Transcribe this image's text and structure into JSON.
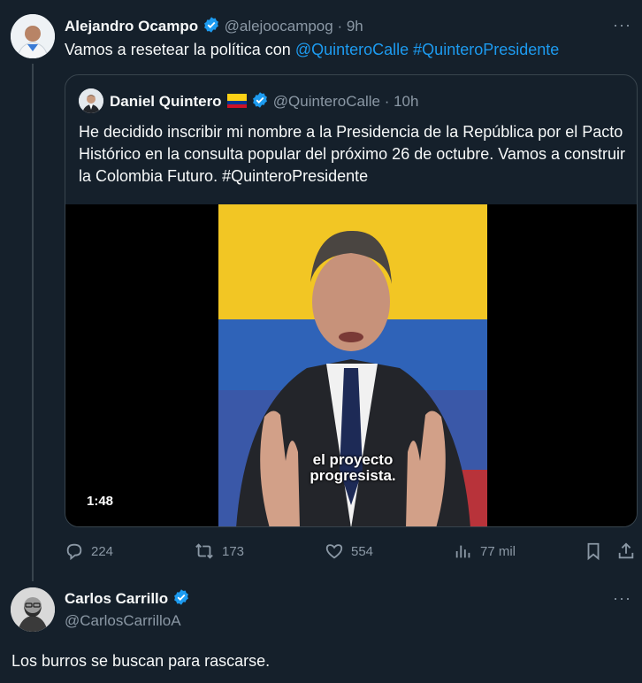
{
  "tweet1": {
    "name": "Alejandro Ocampo",
    "handle": "@alejoocampog",
    "time": "· 9h",
    "text_prefix": "Vamos a resetear la política con",
    "mention": "@QuinteroCalle",
    "hashtag": "#QuinteroPresidente"
  },
  "quote": {
    "name": "Daniel Quintero",
    "handle": "@QuinteroCalle",
    "time": "· 10h",
    "text": "He decidido inscribir mi nombre a la Presidencia de la República por el Pacto Histórico en la consulta popular del próximo 26 de octubre. Vamos a construir la Colombia Futuro. #QuinteroPresidente",
    "video": {
      "duration": "1:48",
      "subtitle_line1": "el proyecto",
      "subtitle_line2": "progresista."
    }
  },
  "actions": {
    "replies": "224",
    "reposts": "173",
    "likes": "554",
    "views": "77 mil"
  },
  "tweet2": {
    "name": "Carlos Carrillo",
    "handle": "@CarlosCarrilloA",
    "text": "Los burros se buscan para rascarse."
  },
  "colors": {
    "background": "#15202b",
    "accent": "#1d9bf0",
    "muted": "#8b98a5",
    "border": "#38444d"
  }
}
